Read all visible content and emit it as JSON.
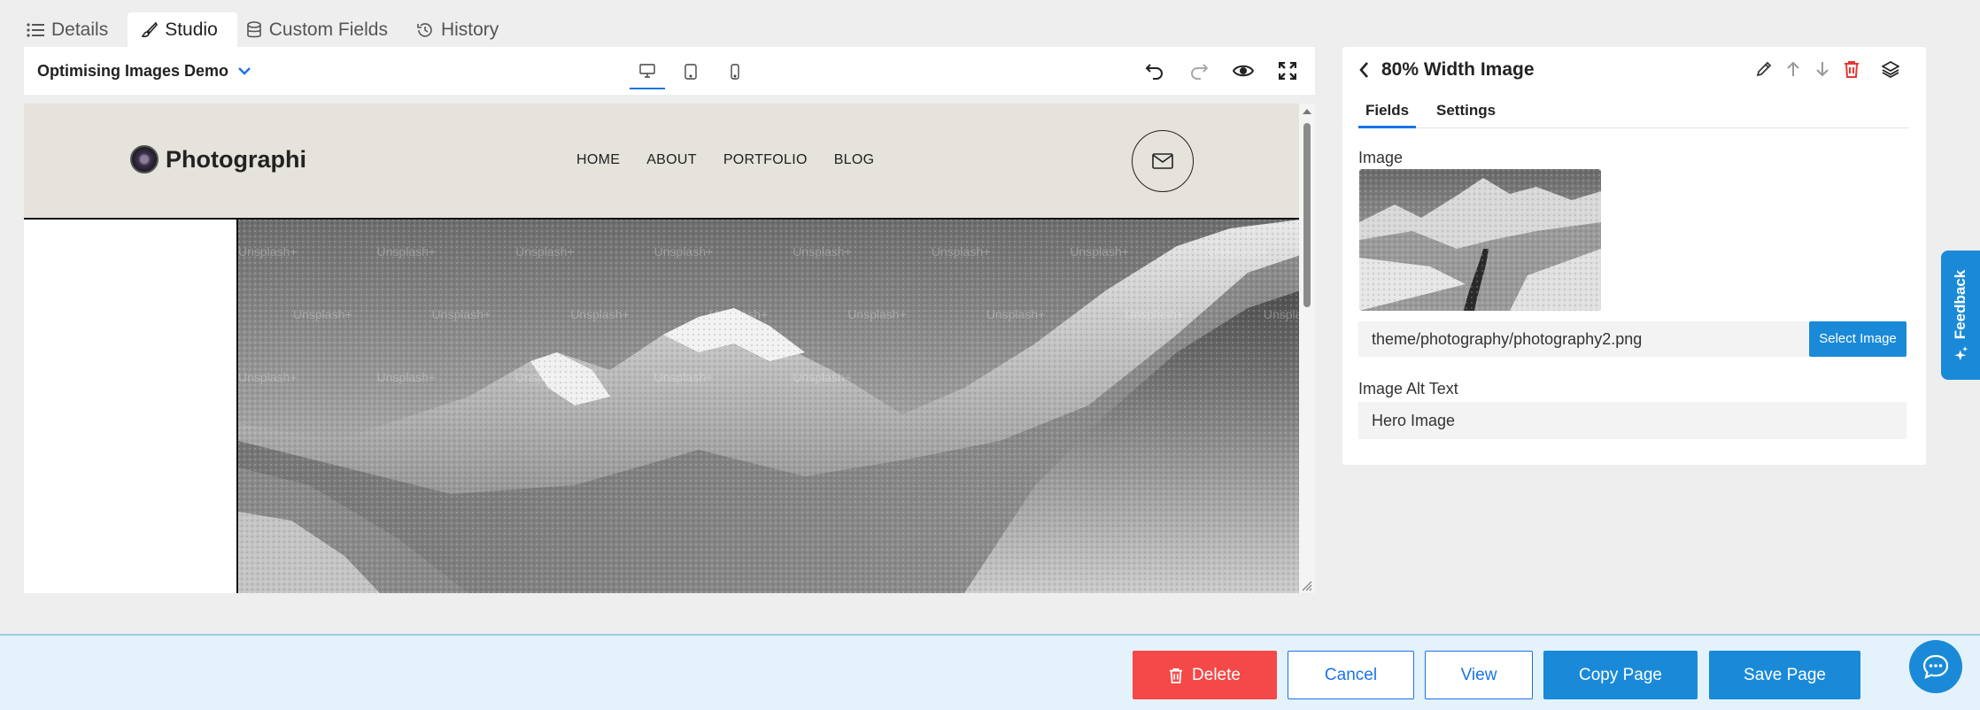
{
  "tabs": [
    {
      "label": "Details",
      "icon": "list-icon"
    },
    {
      "label": "Studio",
      "icon": "brush-icon",
      "active": true
    },
    {
      "label": "Custom Fields",
      "icon": "database-icon"
    },
    {
      "label": "History",
      "icon": "history-icon"
    }
  ],
  "toolbar": {
    "page_name": "Optimising Images Demo",
    "devices": [
      "desktop-icon",
      "tablet-icon",
      "mobile-icon"
    ],
    "active_device": "desktop",
    "tools": [
      "undo-icon",
      "redo-icon",
      "preview-eye-icon",
      "fullscreen-icon"
    ]
  },
  "site": {
    "logo_text": "Photographi",
    "nav": [
      "HOME",
      "ABOUT",
      "PORTFOLIO",
      "BLOG"
    ],
    "watermark": "Unsplash+"
  },
  "panel": {
    "title": "80% Width Image",
    "tabs": [
      "Fields",
      "Settings"
    ],
    "image_label": "Image",
    "image_path": "theme/photography/photography2.png",
    "select_image_label": "Select Image",
    "alt_label": "Image Alt Text",
    "alt_value": "Hero Image"
  },
  "feedback_label": "Feedback",
  "actions": {
    "delete": "Delete",
    "cancel": "Cancel",
    "view": "View",
    "copy": "Copy Page",
    "save": "Save Page"
  },
  "colors": {
    "accent": "#1a8ad8",
    "danger": "#f54848",
    "header_bg": "#e6e2dc",
    "bottom_bar": "#e4f2fb"
  }
}
